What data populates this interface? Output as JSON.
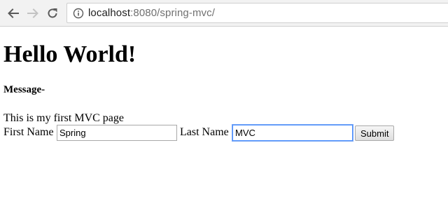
{
  "browser": {
    "back_icon": "arrow-left-icon",
    "forward_icon": "arrow-right-icon",
    "reload_icon": "reload-icon",
    "info_icon": "info-circle-icon",
    "url_host": "localhost",
    "url_rest": ":8080/spring-mvc/"
  },
  "page": {
    "heading": "Hello World!",
    "subheading": "Message-",
    "paragraph": "This is my first MVC page",
    "form": {
      "first_name_label": "First Name",
      "first_name_value": "Spring",
      "last_name_label": "Last Name",
      "last_name_value": "MVC",
      "submit_label": "Submit"
    }
  }
}
